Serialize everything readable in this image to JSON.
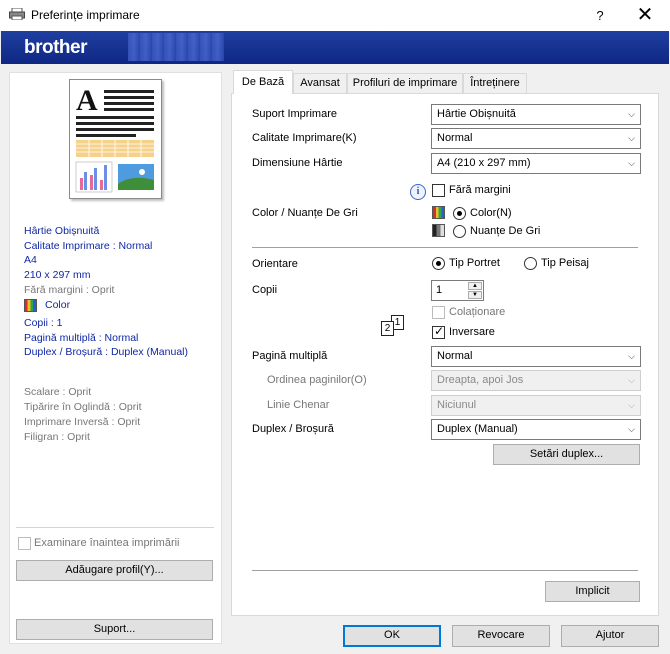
{
  "window": {
    "title": "Preferințe imprimare",
    "help": "?",
    "close": "✕"
  },
  "banner": {
    "logo": "brother"
  },
  "left": {
    "info_blue": [
      "Hârtie Obișnuită",
      "Calitate Imprimare : Normal",
      "A4",
      "210 x 297 mm"
    ],
    "borderless": "Fără margini : Oprit",
    "color": "Color",
    "info_blue2": [
      "Copii : 1",
      "Pagină multiplă : Normal",
      "Duplex / Broșură : Duplex (Manual)"
    ],
    "info_gray": [
      "Scalare : Oprit",
      "Tipărire în Oglindă : Oprit",
      "Imprimare Inversă : Oprit",
      "Filigran : Oprit"
    ],
    "preview_check": "Examinare înaintea imprimării",
    "add_profile": "Adăugare profil(Y)...",
    "support": "Suport..."
  },
  "tabs": [
    "De Bază",
    "Avansat",
    "Profiluri de imprimare",
    "Întreținere"
  ],
  "form": {
    "media_label": "Suport Imprimare",
    "media_value": "Hârtie Obișnuită",
    "quality_label": "Calitate Imprimare(K)",
    "quality_value": "Normal",
    "size_label": "Dimensiune Hârtie",
    "size_value": "A4 (210 x 297 mm)",
    "borderless": "Fără margini",
    "color_label": "Color / Nuanțe De Gri",
    "color_opt": "Color(N)",
    "gray_opt": "Nuanțe De Gri",
    "orientation_label": "Orientare",
    "portrait": "Tip Portret",
    "landscape": "Tip Peisaj",
    "copies_label": "Copii",
    "copies_value": "1",
    "collate": "Colaționare",
    "reverse": "Inversare",
    "multipage_label": "Pagină multiplă",
    "multipage_value": "Normal",
    "order_label": "Ordinea paginilor(O)",
    "order_value": "Dreapta, apoi Jos",
    "border_label": "Linie Chenar",
    "border_value": "Niciunul",
    "duplex_label": "Duplex / Broșură",
    "duplex_value": "Duplex (Manual)",
    "duplex_settings": "Setări duplex...",
    "default": "Implicit"
  },
  "footer": {
    "ok": "OK",
    "cancel": "Revocare",
    "help": "Ajutor"
  }
}
